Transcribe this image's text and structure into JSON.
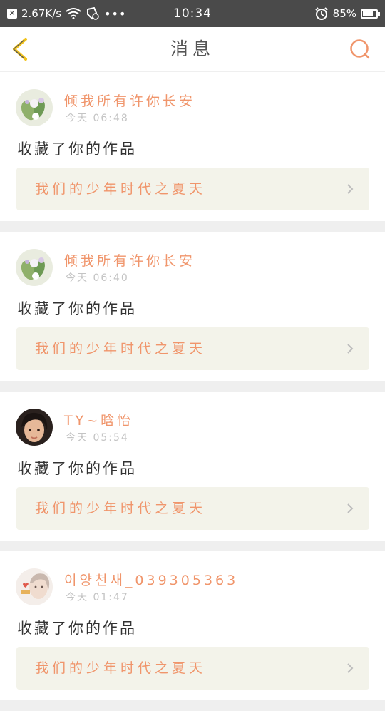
{
  "status_bar": {
    "network_speed": "2.67K/s",
    "time": "10:34",
    "battery": "85%",
    "battery_level": 0.85,
    "icons": [
      "close-box-icon",
      "wifi-icon",
      "shield-icon",
      "more-dots-icon",
      "alarm-icon",
      "battery-icon"
    ]
  },
  "nav": {
    "title": "消息",
    "back_icon": "chevron-left-icon",
    "search_icon": "search-icon",
    "accent_color": "#f0956b",
    "back_color": "#f2c31b"
  },
  "messages": [
    {
      "user": "倾我所有许你长安",
      "time": "今天 06:48",
      "action": "收藏了你的作品",
      "work": "我们的少年时代之夏天",
      "avatar": "flower-avatar"
    },
    {
      "user": "倾我所有许你长安",
      "time": "今天 06:40",
      "action": "收藏了你的作品",
      "work": "我们的少年时代之夏天",
      "avatar": "flower-avatar"
    },
    {
      "user": "TY~晗怡",
      "time": "今天 05:54",
      "action": "收藏了你的作品",
      "work": "我们的少年时代之夏天",
      "avatar": "portrait-avatar"
    },
    {
      "user": "이양천새_039305363",
      "time": "今天 01:47",
      "action": "收藏了你的作品",
      "work": "我们的少年时代之夏天",
      "avatar": "light-portrait-avatar"
    }
  ]
}
